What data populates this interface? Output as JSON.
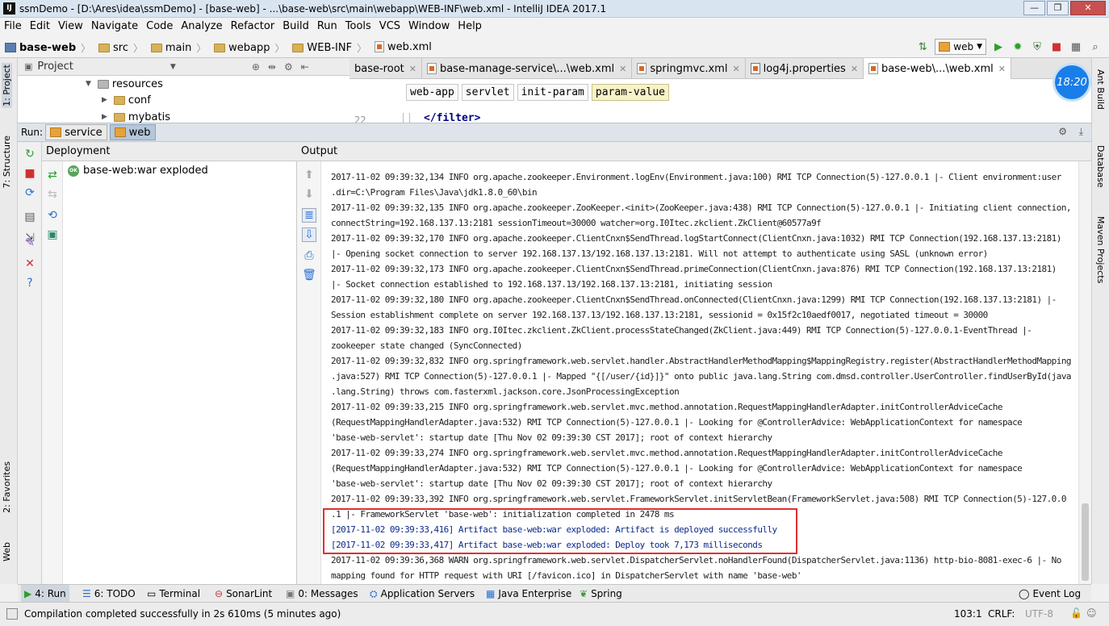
{
  "window": {
    "title": "ssmDemo - [D:\\Ares\\idea\\ssmDemo] - [base-web] - ...\\base-web\\src\\main\\webapp\\WEB-INF\\web.xml - IntelliJ IDEA 2017.1",
    "app_icon": "IJ",
    "controls": [
      "—",
      "❐",
      "✕"
    ]
  },
  "menu": [
    "File",
    "Edit",
    "View",
    "Navigate",
    "Code",
    "Analyze",
    "Refactor",
    "Build",
    "Run",
    "Tools",
    "VCS",
    "Window",
    "Help"
  ],
  "breadcrumb": [
    "base-web",
    "src",
    "main",
    "webapp",
    "WEB-INF",
    "web.xml"
  ],
  "toolbar": {
    "run_config": "web"
  },
  "project": {
    "header": "Project",
    "tree": [
      {
        "label": "resources",
        "expanded": true
      },
      {
        "label": "conf",
        "expanded": false
      },
      {
        "label": "mybatis",
        "expanded": false
      }
    ]
  },
  "editor": {
    "tabs": [
      "base-root",
      "base-manage-service\\...\\web.xml",
      "springmvc.xml",
      "log4j.properties",
      "base-web\\...\\web.xml"
    ],
    "active_tab": 4,
    "xml_breadcrumbs": [
      "web-app",
      "servlet",
      "init-param",
      "param-value"
    ],
    "line_number": "22",
    "code_line": "</filter>"
  },
  "clock": "18:20",
  "left_strip": [
    "1: Project",
    "7: Structure",
    "2: Favorites",
    "Web"
  ],
  "right_strip": [
    "Ant Build",
    "Database",
    "Maven Projects"
  ],
  "run": {
    "label": "Run:",
    "tabs": [
      "service",
      "web"
    ],
    "active_tab": 1,
    "deployment_header": "Deployment",
    "deployment_item": "base-web:war exploded",
    "deployment_badge": "OK",
    "output_header": "Output",
    "output_lines": [
      "2017-11-02 09:39:32,134 INFO  org.apache.zookeeper.Environment.logEnv(Environment.java:100) RMI TCP Connection(5)-127.0.0.1 |- Client environment:user",
      " .dir=C:\\Program Files\\Java\\jdk1.8.0_60\\bin",
      "2017-11-02 09:39:32,135 INFO  org.apache.zookeeper.ZooKeeper.<init>(ZooKeeper.java:438) RMI TCP Connection(5)-127.0.0.1 |- Initiating client connection,",
      "  connectString=192.168.137.13:2181 sessionTimeout=30000 watcher=org.I0Itec.zkclient.ZkClient@60577a9f",
      "2017-11-02 09:39:32,170 INFO  org.apache.zookeeper.ClientCnxn$SendThread.logStartConnect(ClientCnxn.java:1032) RMI TCP Connection(192.168.137.13:2181)",
      " |- Opening socket connection to server 192.168.137.13/192.168.137.13:2181. Will not attempt to authenticate using SASL (unknown error)",
      "2017-11-02 09:39:32,173 INFO  org.apache.zookeeper.ClientCnxn$SendThread.primeConnection(ClientCnxn.java:876) RMI TCP Connection(192.168.137.13:2181)",
      " |- Socket connection established to 192.168.137.13/192.168.137.13:2181, initiating session",
      "2017-11-02 09:39:32,180 INFO  org.apache.zookeeper.ClientCnxn$SendThread.onConnected(ClientCnxn.java:1299) RMI TCP Connection(192.168.137.13:2181) |-",
      " Session establishment complete on server 192.168.137.13/192.168.137.13:2181, sessionid = 0x15f2c10aedf0017, negotiated timeout = 30000",
      "2017-11-02 09:39:32,183 INFO  org.I0Itec.zkclient.ZkClient.processStateChanged(ZkClient.java:449) RMI TCP Connection(5)-127.0.0.1-EventThread |-",
      " zookeeper state changed (SyncConnected)",
      "2017-11-02 09:39:32,832 INFO  org.springframework.web.servlet.handler.AbstractHandlerMethodMapping$MappingRegistry.register(AbstractHandlerMethodMapping",
      " .java:527) RMI TCP Connection(5)-127.0.0.1 |- Mapped \"{[/user/{id}]}\" onto public java.lang.String com.dmsd.controller.UserController.findUserById(java",
      " .lang.String) throws com.fasterxml.jackson.core.JsonProcessingException",
      "2017-11-02 09:39:33,215 INFO  org.springframework.web.servlet.mvc.method.annotation.RequestMappingHandlerAdapter.initControllerAdviceCache",
      " (RequestMappingHandlerAdapter.java:532) RMI TCP Connection(5)-127.0.0.1 |- Looking for @ControllerAdvice: WebApplicationContext for namespace",
      " 'base-web-servlet': startup date [Thu Nov 02 09:39:30 CST 2017]; root of context hierarchy",
      "2017-11-02 09:39:33,274 INFO  org.springframework.web.servlet.mvc.method.annotation.RequestMappingHandlerAdapter.initControllerAdviceCache",
      " (RequestMappingHandlerAdapter.java:532) RMI TCP Connection(5)-127.0.0.1 |- Looking for @ControllerAdvice: WebApplicationContext for namespace",
      " 'base-web-servlet': startup date [Thu Nov 02 09:39:30 CST 2017]; root of context hierarchy",
      "2017-11-02 09:39:33,392 INFO  org.springframework.web.servlet.FrameworkServlet.initServletBean(FrameworkServlet.java:508) RMI TCP Connection(5)-127.0.0",
      " .1 |- FrameworkServlet 'base-web': initialization completed in 2478 ms",
      "[2017-11-02 09:39:33,416] Artifact base-web:war exploded: Artifact is deployed successfully",
      "[2017-11-02 09:39:33,417] Artifact base-web:war exploded: Deploy took 7,173 milliseconds",
      "2017-11-02 09:39:36,368 WARN  org.springframework.web.servlet.DispatcherServlet.noHandlerFound(DispatcherServlet.java:1136) http-bio-8081-exec-6 |- No",
      " mapping found for HTTP request with URI [/favicon.ico] in DispatcherServlet with name 'base-web'"
    ]
  },
  "bottom_tabs": [
    "4: Run",
    "6: TODO",
    "Terminal",
    "SonarLint",
    "0: Messages",
    "Application Servers",
    "Java Enterprise",
    "Spring",
    "Event Log"
  ],
  "status": {
    "message": "Compilation completed successfully in 2s 610ms (5 minutes ago)",
    "position": "103:1",
    "line_sep": "CRLF:",
    "encoding": "UTF-8"
  },
  "colors": {
    "accent": "#1a7ee8",
    "highlight_box": "#e03030",
    "deploy_text": "#0a2a8a"
  }
}
